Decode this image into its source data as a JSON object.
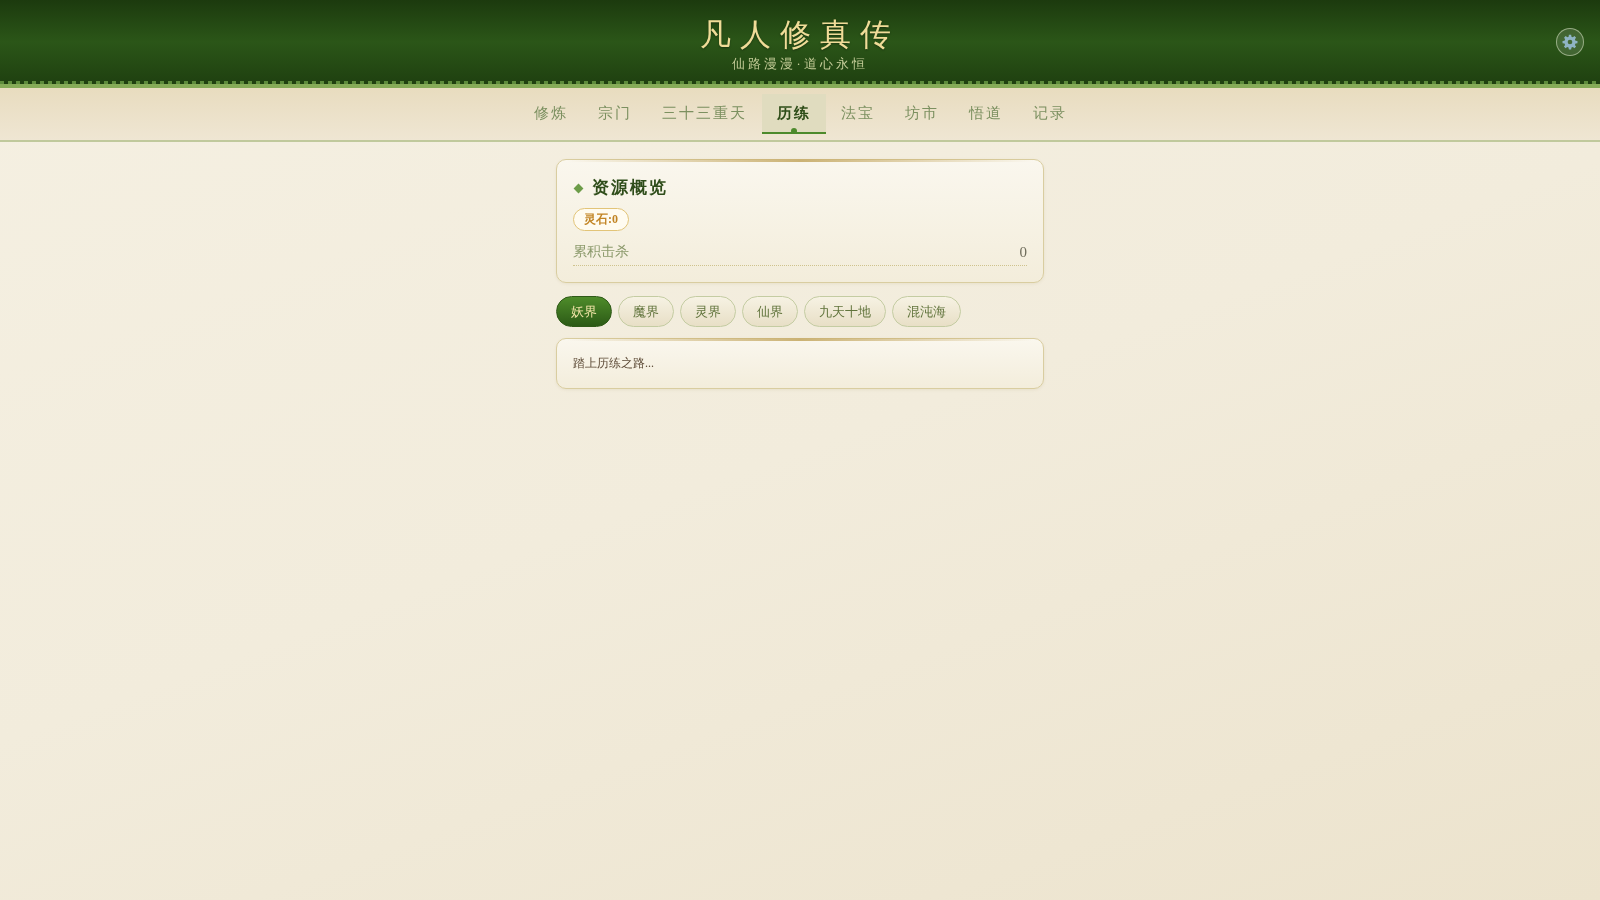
{
  "header": {
    "title": "凡人修真传",
    "subtitle": "仙路漫漫·道心永恒"
  },
  "nav_tabs": [
    {
      "label": "修炼",
      "selected": false
    },
    {
      "label": "宗门",
      "selected": false
    },
    {
      "label": "三十三重天",
      "selected": false
    },
    {
      "label": "历练",
      "selected": true
    },
    {
      "label": "法宝",
      "selected": false
    },
    {
      "label": "坊市",
      "selected": false
    },
    {
      "label": "悟道",
      "selected": false
    },
    {
      "label": "记录",
      "selected": false
    }
  ],
  "resource_card": {
    "title": "资源概览",
    "badges": [
      "灵石:0"
    ],
    "stats": [
      {
        "label": "累积击杀",
        "value": "0"
      }
    ]
  },
  "region_tabs": [
    {
      "label": "妖界",
      "selected": true
    },
    {
      "label": "魔界",
      "selected": false
    },
    {
      "label": "灵界",
      "selected": false
    },
    {
      "label": "仙界",
      "selected": false
    },
    {
      "label": "九天十地",
      "selected": false
    },
    {
      "label": "混沌海",
      "selected": false
    }
  ],
  "log_panel": {
    "text": "踏上历练之路..."
  }
}
